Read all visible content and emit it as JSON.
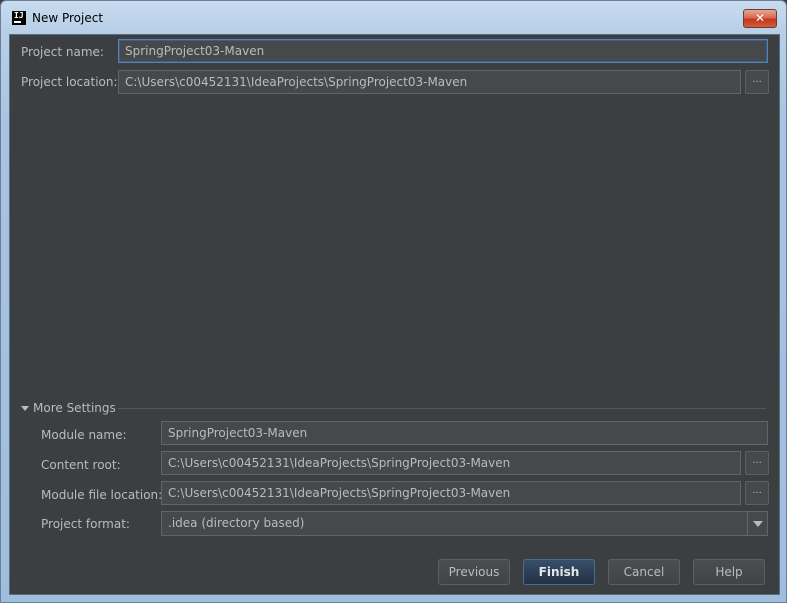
{
  "window": {
    "title": "New Project",
    "close_glyph": "✕"
  },
  "fields": {
    "project_name": {
      "label": "Project name:",
      "value": "SpringProject03-Maven"
    },
    "project_location": {
      "label": "Project location:",
      "value": "C:\\Users\\c00452131\\IdeaProjects\\SpringProject03-Maven"
    }
  },
  "more_settings": {
    "title": "More Settings",
    "module_name": {
      "label": "Module name:",
      "value": "SpringProject03-Maven"
    },
    "content_root": {
      "label": "Content root:",
      "value": "C:\\Users\\c00452131\\IdeaProjects\\SpringProject03-Maven"
    },
    "module_file_location": {
      "label": "Module file location:",
      "value": "C:\\Users\\c00452131\\IdeaProjects\\SpringProject03-Maven"
    },
    "project_format": {
      "label": "Project format:",
      "value": ".idea (directory based)"
    }
  },
  "browse_glyph": "...",
  "buttons": {
    "previous": "Previous",
    "finish": "Finish",
    "cancel": "Cancel",
    "help": "Help"
  },
  "colors": {
    "panel": "#3c3f41",
    "field": "#45494a",
    "text": "#bbbbbb",
    "accent": "#5a81b3"
  }
}
